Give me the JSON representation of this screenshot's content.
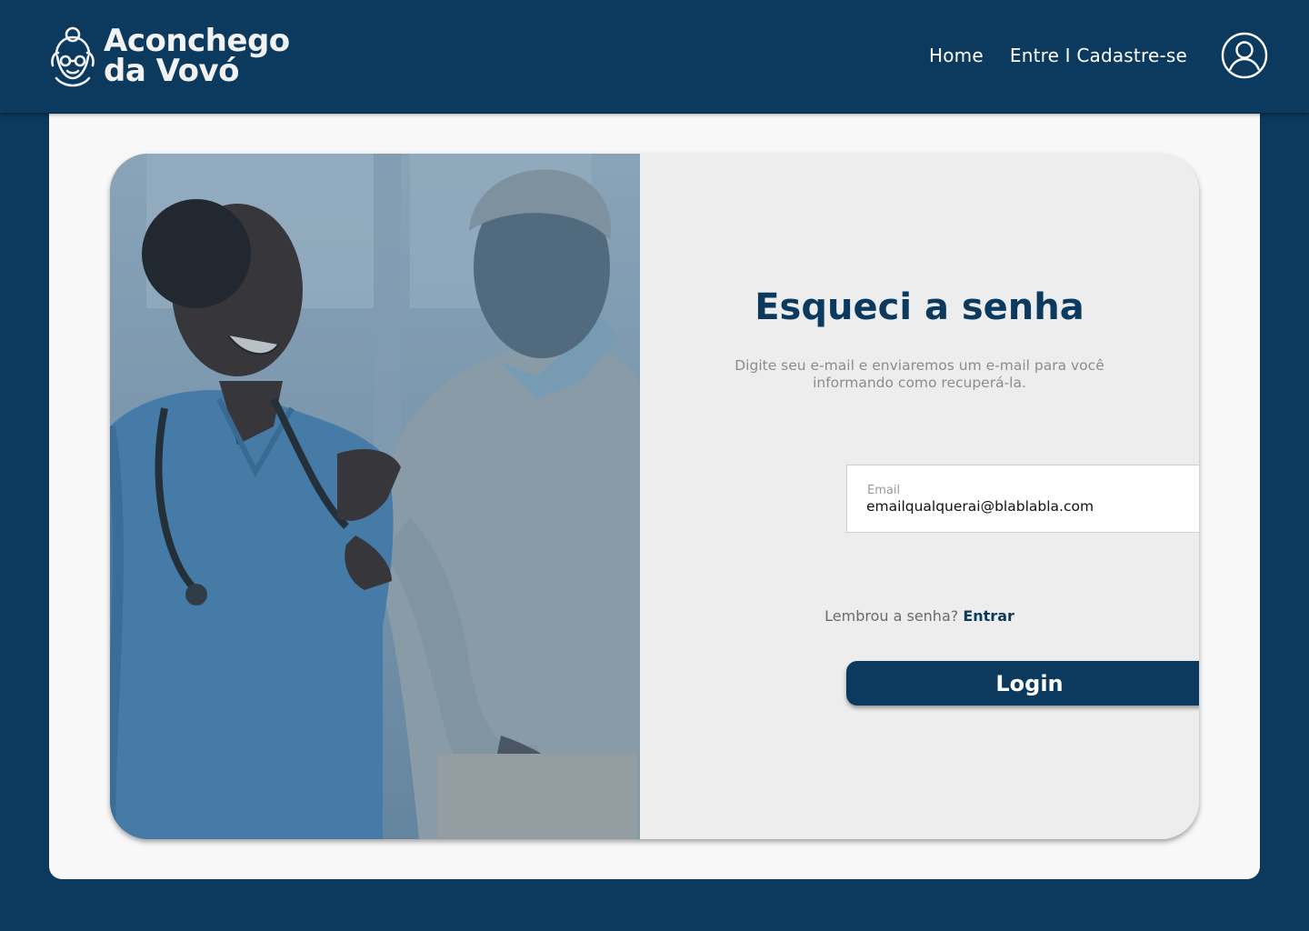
{
  "header": {
    "brand_line1": "Aconchego",
    "brand_line2": "da Vovó",
    "logo_icon": "grandma-face-icon",
    "nav": {
      "home": "Home",
      "login_register": "Entre I Cadastre-se"
    },
    "profile_icon": "user-circle-icon"
  },
  "form": {
    "title": "Esqueci a senha",
    "subtitle": "Digite seu e-mail e enviaremos um e-mail para você informando como recuperá-la.",
    "email_label": "Email",
    "email_value": "emailqualquerai@blablabla.com",
    "remember_text": "Lembrou a senha?",
    "remember_link": "Entrar",
    "submit_label": "Login"
  },
  "colors": {
    "brand": "#0c3a5e",
    "card_bg": "#f8f8f8",
    "form_bg": "#ededed",
    "muted_text": "#8c8c8c"
  }
}
